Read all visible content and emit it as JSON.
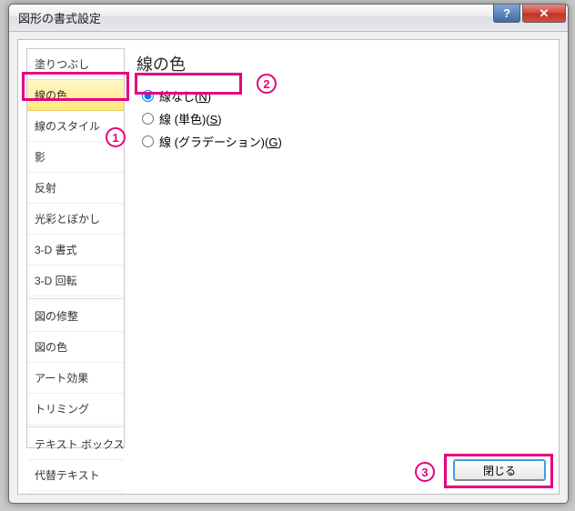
{
  "window": {
    "title": "図形の書式設定",
    "help_glyph": "?",
    "close_glyph": "✕"
  },
  "sidebar": {
    "items": [
      "塗りつぶし",
      "線の色",
      "線のスタイル",
      "影",
      "反射",
      "光彩とぼかし",
      "3-D 書式",
      "3-D 回転",
      "図の修整",
      "図の色",
      "アート効果",
      "トリミング",
      "テキスト ボックス",
      "代替テキスト"
    ],
    "selected_index": 1
  },
  "panel": {
    "title": "線の色",
    "radios": [
      {
        "label_prefix": "線なし(",
        "key": "N",
        "label_suffix": ")",
        "checked": true
      },
      {
        "label_prefix": "線 (単色)(",
        "key": "S",
        "label_suffix": ")",
        "checked": false
      },
      {
        "label_prefix": "線 (グラデーション)(",
        "key": "G",
        "label_suffix": ")",
        "checked": false
      }
    ]
  },
  "footer": {
    "close_label": "閉じる"
  },
  "annotations": {
    "n1": "1",
    "n2": "2",
    "n3": "3"
  }
}
